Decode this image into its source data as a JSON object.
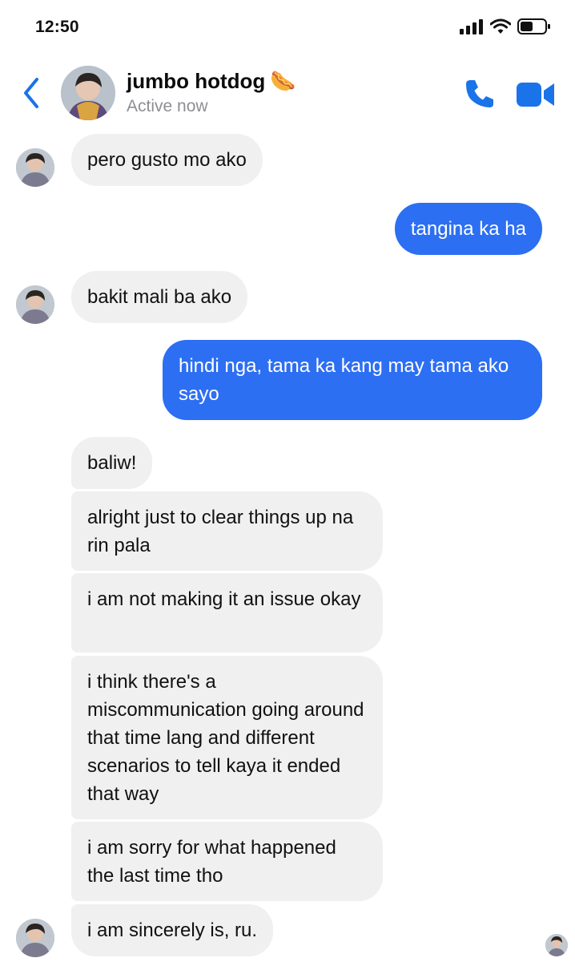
{
  "status_bar": {
    "time": "12:50",
    "icons": [
      "signal-icon",
      "wifi-icon",
      "battery-icon"
    ]
  },
  "header": {
    "back_icon": "chevron-left-icon",
    "contact_name": "jumbo hotdog",
    "contact_emoji": "🌭",
    "contact_status": "Active now",
    "call_icon": "phone-icon",
    "video_icon": "video-camera-icon"
  },
  "messages": [
    {
      "from": "them",
      "text": "pero gusto mo ako"
    },
    {
      "from": "me",
      "text": "tangina ka ha"
    },
    {
      "from": "them",
      "text": "bakit mali ba ako"
    },
    {
      "from": "me",
      "text": "hindi nga, tama ka kang may tama ako sayo"
    },
    {
      "from": "them",
      "text": "baliw!"
    },
    {
      "from": "them",
      "text": "alright just to clear things up na rin pala"
    },
    {
      "from": "them",
      "text": "i am not making it an issue okay"
    },
    {
      "from": "them",
      "text": "i think there's a miscommunication going around that time lang and different scenarios to tell kaya it ended that way"
    },
    {
      "from": "them",
      "text": "i am sorry for what happened the last time tho"
    },
    {
      "from": "them",
      "text": "i am sincerely is, ru."
    }
  ],
  "colors": {
    "accent": "#1a73e8",
    "outgoing_bubble": "#2d6ff2",
    "incoming_bubble": "#f0f0f0",
    "status_gray": "#8e8e93"
  }
}
